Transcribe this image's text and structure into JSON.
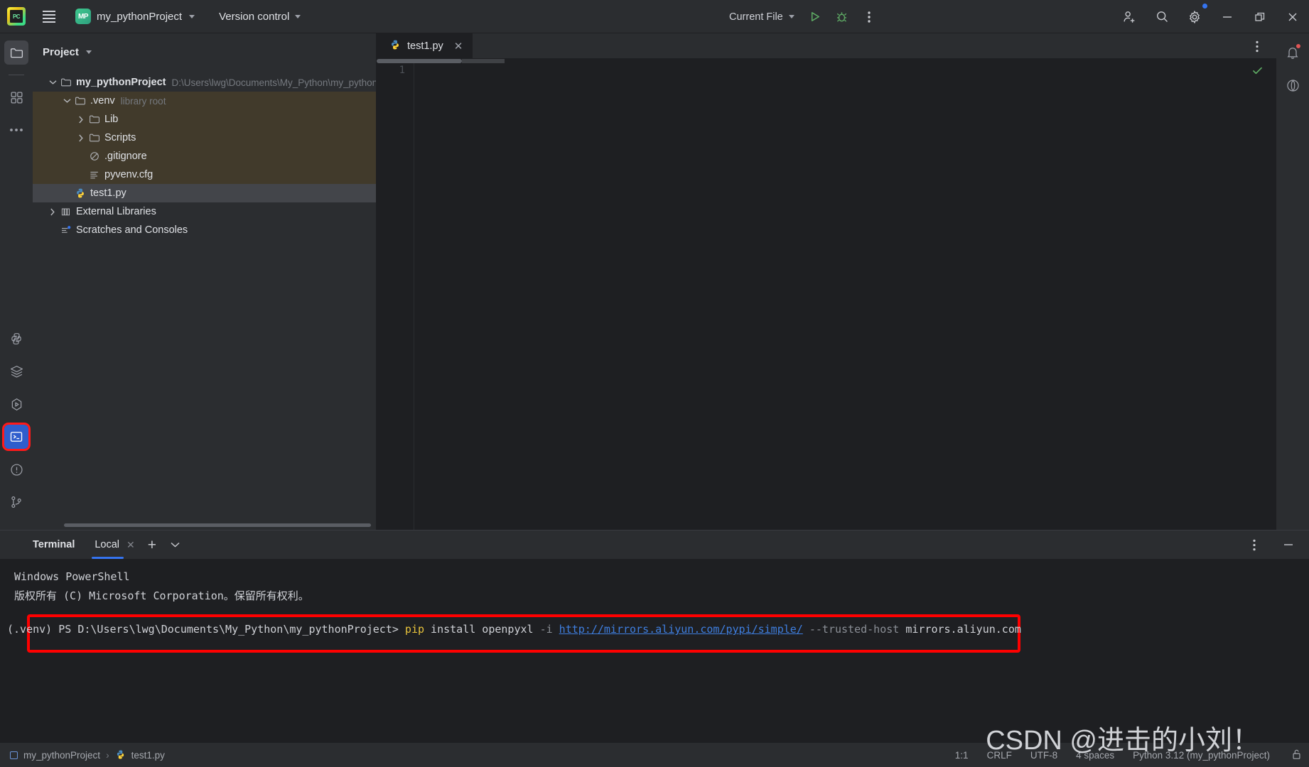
{
  "titlebar": {
    "logo_alt": "pycharm-logo",
    "project_badge": "MP",
    "project_name": "my_pythonProject",
    "version_control": "Version control",
    "run_config": "Current File",
    "icons": [
      "run-icon",
      "debug-icon",
      "more-actions-icon",
      "add-user-icon",
      "search-everywhere-icon",
      "settings-icon"
    ],
    "window": {
      "minimize": "minimize-icon",
      "maximize": "maximize-icon",
      "close": "close-icon"
    }
  },
  "left_rail": {
    "items": [
      {
        "name": "project-tool-icon",
        "label": "Project"
      },
      {
        "name": "structure-tool-icon",
        "label": "Structure"
      },
      {
        "name": "more-tool-windows-icon",
        "label": "More tool windows"
      }
    ],
    "bottom_items": [
      {
        "name": "python-packages-icon",
        "label": "Python Packages"
      },
      {
        "name": "services-icon",
        "label": "Services"
      },
      {
        "name": "run-tool-icon",
        "label": "Run"
      },
      {
        "name": "terminal-tool-icon",
        "label": "Terminal"
      },
      {
        "name": "problems-icon",
        "label": "Problems"
      },
      {
        "name": "version-control-icon",
        "label": "Version Control"
      }
    ]
  },
  "project_panel": {
    "title": "Project",
    "tree": [
      {
        "indent": 0,
        "arrow": "expanded",
        "icon": "folder-icon",
        "label": "my_pythonProject",
        "sub": "D:\\Users\\lwg\\Documents\\My_Python\\my_python",
        "bold": true,
        "state": "normal"
      },
      {
        "indent": 1,
        "arrow": "expanded",
        "icon": "folder-icon",
        "label": ".venv",
        "sub": "library root",
        "bold": false,
        "state": "venv"
      },
      {
        "indent": 2,
        "arrow": "collapsed",
        "icon": "folder-icon",
        "label": "Lib",
        "sub": "",
        "bold": false,
        "state": "venv"
      },
      {
        "indent": 2,
        "arrow": "collapsed",
        "icon": "folder-icon",
        "label": "Scripts",
        "sub": "",
        "bold": false,
        "state": "venv"
      },
      {
        "indent": 2,
        "arrow": "none",
        "icon": "gitignore-icon",
        "label": ".gitignore",
        "sub": "",
        "bold": false,
        "state": "venv"
      },
      {
        "indent": 2,
        "arrow": "none",
        "icon": "config-file-icon",
        "label": "pyvenv.cfg",
        "sub": "",
        "bold": false,
        "state": "venv"
      },
      {
        "indent": 1,
        "arrow": "none",
        "icon": "python-file-icon",
        "label": "test1.py",
        "sub": "",
        "bold": false,
        "state": "selected"
      },
      {
        "indent": 0,
        "arrow": "collapsed",
        "icon": "external-libraries-icon",
        "label": "External Libraries",
        "sub": "",
        "bold": false,
        "state": "normal"
      },
      {
        "indent": 0,
        "arrow": "none",
        "icon": "scratches-icon",
        "label": "Scratches and Consoles",
        "sub": "",
        "bold": false,
        "state": "normal"
      }
    ]
  },
  "editor": {
    "tab": {
      "label": "test1.py",
      "icon": "python-file-icon",
      "close": "close-icon"
    },
    "more_icon": "more-options-icon",
    "line_numbers": [
      "1"
    ],
    "content": "",
    "inspection_status": "ok-check-icon"
  },
  "right_rail": {
    "items": [
      {
        "name": "notifications-icon",
        "label": "Notifications"
      },
      {
        "name": "ai-assistant-icon",
        "label": "AI Assistant"
      }
    ]
  },
  "terminal": {
    "title": "Terminal",
    "tab": "Local",
    "close_tab": "close-icon",
    "new_tab": "add-icon",
    "tab_list": "chevron-down-icon",
    "options_icon": "more-options-icon",
    "minimize_icon": "minimize-icon",
    "lines": [
      "Windows PowerShell",
      "版权所有 (C) Microsoft Corporation。保留所有权利。"
    ],
    "command": {
      "prompt": "(.venv) PS D:\\Users\\lwg\\Documents\\My_Python\\my_pythonProject>",
      "cmd": "pip",
      "args_before": " install openpyxl ",
      "flag_i": "-i",
      "url": "http://mirrors.aliyun.com/pypi/simple/",
      "flag_trusted": "--trusted-host",
      "host": "mirrors.aliyun.com",
      "highlight_color": "#fe0000"
    }
  },
  "status_bar": {
    "breadcrumb_project": "my_pythonProject",
    "breadcrumb_sep": "›",
    "breadcrumb_file": "test1.py",
    "caret": "1:1",
    "line_sep": "CRLF",
    "encoding": "UTF-8",
    "indent": "4 spaces",
    "interpreter": "Python 3.12 (my_pythonProject)",
    "lock_icon": "unlocked-icon"
  },
  "watermark": "CSDN @进击的小刘！",
  "colors": {
    "accent_blue": "#3574f0",
    "highlight_red": "#fe0000",
    "venv_row": "#413A2B",
    "selected_row": "#43454a",
    "panel_bg": "#2b2d30",
    "editor_bg": "#1e1f22"
  }
}
